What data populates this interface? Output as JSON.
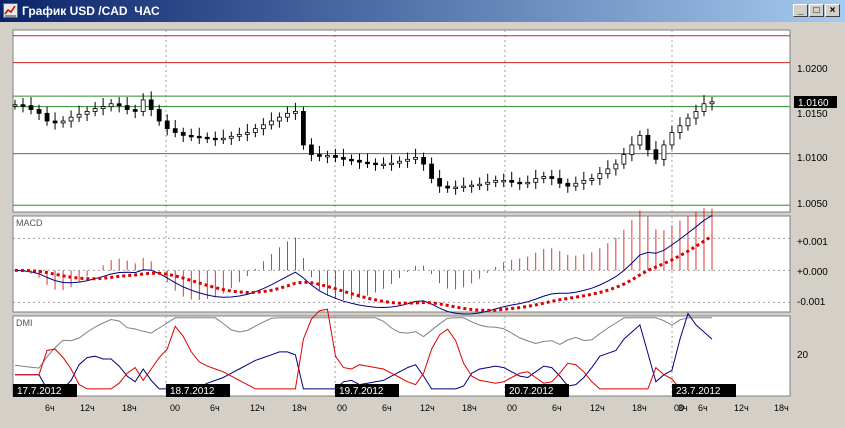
{
  "window": {
    "title": "График USD /CAD  ЧАС",
    "controls": {
      "minimize": "_",
      "maximize": "□",
      "close": "×"
    }
  },
  "colors": {
    "panel_bg": "#ffffff",
    "grid": "#a0a0a0",
    "resistance": "#cc2222",
    "support": "#2e8b2e",
    "macd_line": "#000080",
    "macd_signal": "#dd0000",
    "dmi_plus": "#000080",
    "dmi_minus": "#dd0000",
    "adx": "#808080"
  },
  "price_panel": {
    "y_range": [
      1.0045,
      1.0235
    ],
    "y_ticks": [
      "1.0200",
      "1.0150",
      "1.0100",
      "1.0050"
    ],
    "current_price": "1.0160",
    "horizontal_levels": [
      {
        "value": 1.0229,
        "kind": "resistance"
      },
      {
        "value": 1.0201,
        "kind": "resistance"
      },
      {
        "value": 1.0166,
        "kind": "support"
      },
      {
        "value": 1.0155,
        "kind": "support"
      },
      {
        "value": 1.0106,
        "kind": "support"
      },
      {
        "value": 1.0052,
        "kind": "support"
      }
    ],
    "close_series": [
      1.0157,
      1.0156,
      1.0152,
      1.0148,
      1.014,
      1.0138,
      1.014,
      1.0144,
      1.0147,
      1.015,
      1.0153,
      1.0155,
      1.0158,
      1.0156,
      1.0152,
      1.015,
      1.0162,
      1.0152,
      1.014,
      1.0132,
      1.0128,
      1.0125,
      1.0124,
      1.0123,
      1.0122,
      1.0121,
      1.0122,
      1.0124,
      1.0126,
      1.0128,
      1.0132,
      1.0136,
      1.014,
      1.0144,
      1.0148,
      1.015,
      1.0115,
      1.0105,
      1.0103,
      1.0104,
      1.0102,
      1.01,
      1.0099,
      1.0097,
      1.0096,
      1.0095,
      1.0095,
      1.0096,
      1.0098,
      1.01,
      1.0102,
      1.0095,
      1.008,
      1.0072,
      1.007,
      1.0071,
      1.0072,
      1.0073,
      1.0074,
      1.0076,
      1.0078,
      1.0078,
      1.0076,
      1.0075,
      1.0076,
      1.008,
      1.0082,
      1.008,
      1.0075,
      1.0072,
      1.0075,
      1.0078,
      1.008,
      1.0085,
      1.009,
      1.0095,
      1.0105,
      1.0115,
      1.0125,
      1.011,
      1.01,
      1.0115,
      1.0128,
      1.0135,
      1.0143,
      1.015,
      1.0158,
      1.016
    ]
  },
  "macd_panel": {
    "label": "MACD",
    "y_range": [
      -0.0013,
      0.0017
    ],
    "y_ticks": [
      "+0.001",
      "+0.000",
      "-0.001"
    ],
    "y_tick_values": [
      0.001,
      0.0,
      -0.001
    ]
  },
  "dmi_panel": {
    "label": "DMI",
    "y_tick": "20"
  },
  "x_axis": {
    "date_labels": [
      "17.7.2012",
      "18.7.2012",
      "19.7.2012",
      "20.7.2012",
      "23.7.2012"
    ],
    "hour_labels": [
      "6ч",
      "12ч",
      "18ч",
      "00",
      "6ч",
      "12ч",
      "18ч",
      "00",
      "6ч",
      "12ч",
      "18ч",
      "00",
      "6ч",
      "12ч",
      "18ч",
      "00",
      "3ч",
      "6ч",
      "12ч",
      "18ч"
    ]
  }
}
